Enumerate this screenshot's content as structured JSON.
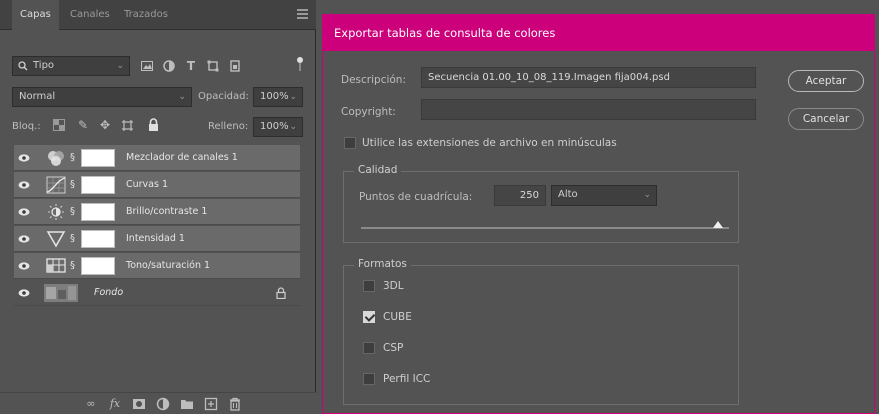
{
  "layers_panel": {
    "tabs": [
      {
        "label": "Capas",
        "active": true
      },
      {
        "label": "Canales",
        "active": false
      },
      {
        "label": "Trazados",
        "active": false
      }
    ],
    "filter_kind": "Tipo",
    "blend_mode": "Normal",
    "opacity_label": "Opacidad:",
    "opacity_value": "100%",
    "lock_label": "Bloq.:",
    "fill_label": "Relleno:",
    "fill_value": "100%",
    "layers": [
      {
        "name": "Mezclador de canales 1",
        "thumb_icon": "channel-mixer-icon",
        "selected": true
      },
      {
        "name": "Curvas 1",
        "thumb_icon": "curves-icon",
        "selected": true
      },
      {
        "name": "Brillo/contraste 1",
        "thumb_icon": "brightness-contrast-icon",
        "selected": true
      },
      {
        "name": "Intensidad 1",
        "thumb_icon": "vibrance-icon",
        "selected": true
      },
      {
        "name": "Tono/saturación 1",
        "thumb_icon": "hue-saturation-icon",
        "selected": true
      },
      {
        "name": "Fondo",
        "thumb_icon": "image-thumbnail",
        "selected": false,
        "locked": true
      }
    ],
    "bottom_icons": [
      "link-layers-icon",
      "fx-icon",
      "add-mask-icon",
      "adjustment-layer-icon",
      "group-folder-icon",
      "new-layer-icon",
      "trash-icon"
    ]
  },
  "export_dialog": {
    "title": "Exportar tablas de consulta de colores",
    "description_label": "Descripción:",
    "description_value": "Secuencia 01.00_10_08_119.Imagen fija004.psd",
    "copyright_label": "Copyright:",
    "copyright_value": "",
    "accept_label": "Aceptar",
    "cancel_label": "Cancelar",
    "lowercase_ext_label": "Utilice las extensiones de archivo en minúsculas",
    "lowercase_ext_checked": false,
    "quality": {
      "title": "Calidad",
      "grid_points_label": "Puntos de cuadrícula:",
      "grid_points_value": "250",
      "quality_level": "Alto",
      "slider_fraction": 0.97
    },
    "formats": {
      "title": "Formatos",
      "items": [
        {
          "label": "3DL",
          "checked": false
        },
        {
          "label": "CUBE",
          "checked": true
        },
        {
          "label": "CSP",
          "checked": false
        },
        {
          "label": "Perfil ICC",
          "checked": false
        }
      ]
    }
  },
  "colors": {
    "accent": "#cc007a",
    "panel_bg": "#535353",
    "selected_layer": "#6a6a6a"
  }
}
